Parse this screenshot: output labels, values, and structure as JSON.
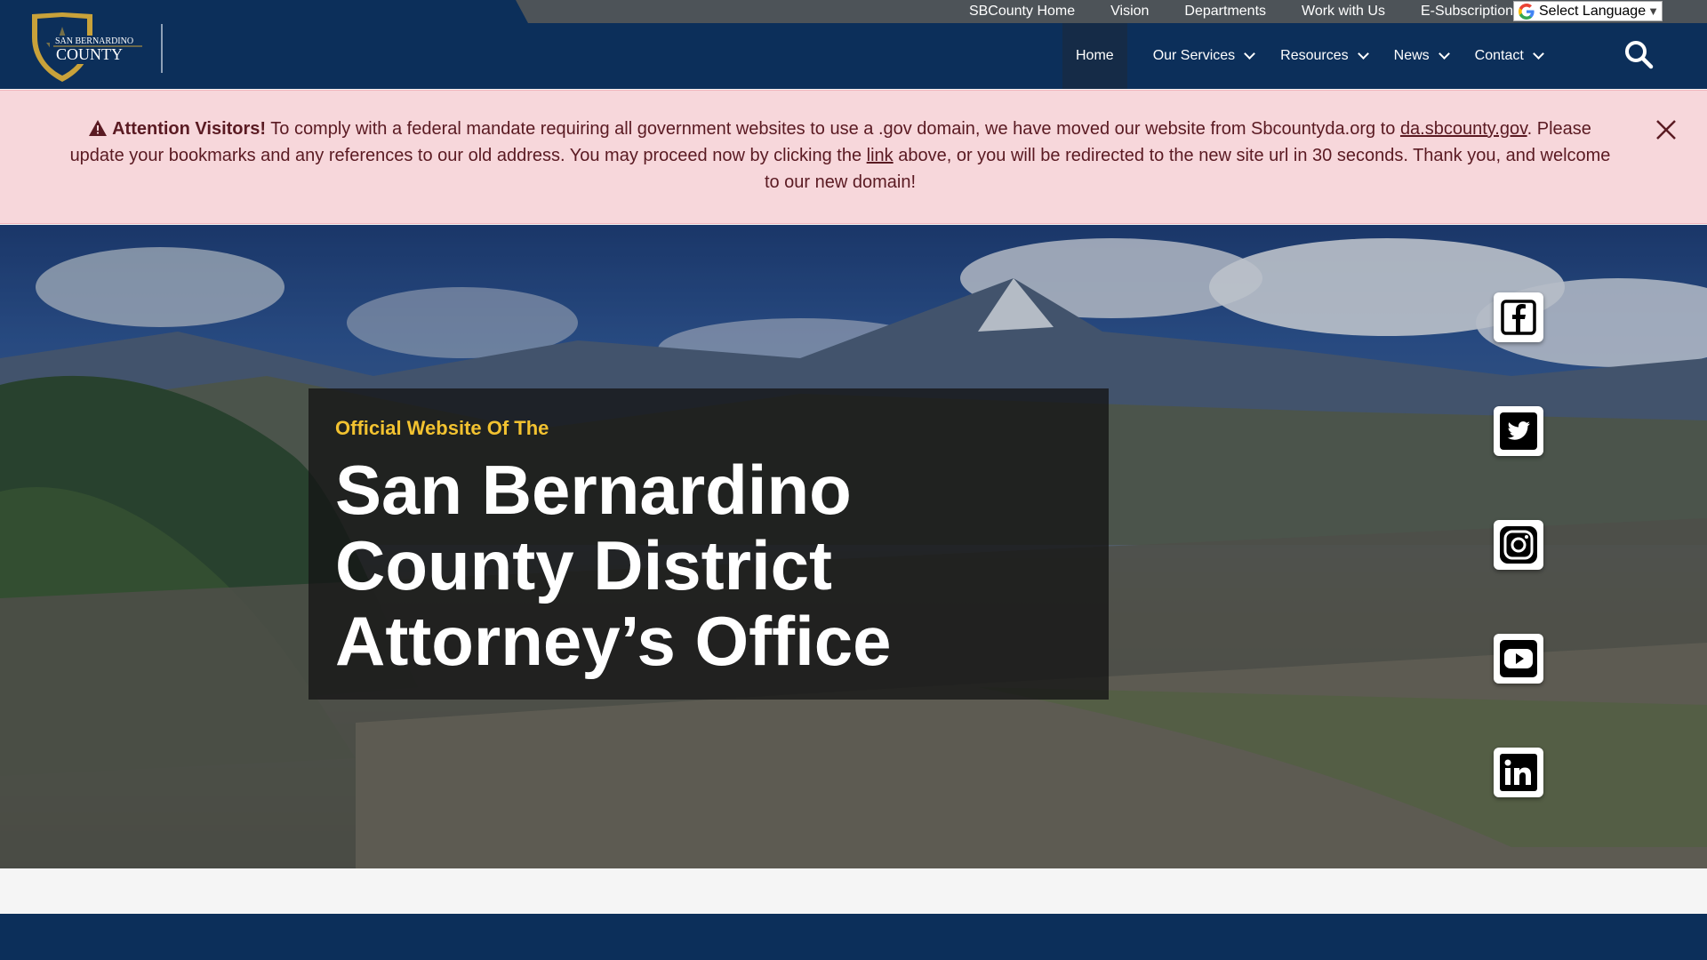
{
  "utility_nav": {
    "links": [
      "SBCounty Home",
      "Vision",
      "Departments",
      "Work with Us",
      "E-Subscriptions"
    ],
    "language_select": "Select Language"
  },
  "logo": {
    "line1": "SAN BERNARDINO",
    "line2": "COUNTY"
  },
  "main_nav": {
    "home": "Home",
    "our_services": "Our Services",
    "resources": "Resources",
    "news": "News",
    "contact": "Contact"
  },
  "alert": {
    "heading": "Attention Visitors!",
    "text1": " To comply with a federal mandate requiring all government websites to use a .gov domain, we have moved our website from Sbcountyda.org to ",
    "link1": "da.sbcounty.gov",
    "text2": ". Please update your bookmarks and any references to our old address. You may proceed now by clicking the ",
    "link2": "link",
    "text3": " above, or you will be redirected to the new site url in 30 seconds. Thank you, and welcome to our new domain!"
  },
  "hero": {
    "eyebrow": "Official Website Of The",
    "title": "San Bernardino County District Attorney’s Office"
  },
  "social": [
    "facebook-icon",
    "twitter-icon",
    "instagram-icon",
    "youtube-icon",
    "linkedin-icon"
  ],
  "colors": {
    "header_bg": "#0c2f5a",
    "utility_bg": "#4d5358",
    "alert_bg": "#f7d7db",
    "alert_text": "#5a1a22",
    "eyebrow": "#f2c230",
    "logo_gold": "#c9a23a"
  }
}
